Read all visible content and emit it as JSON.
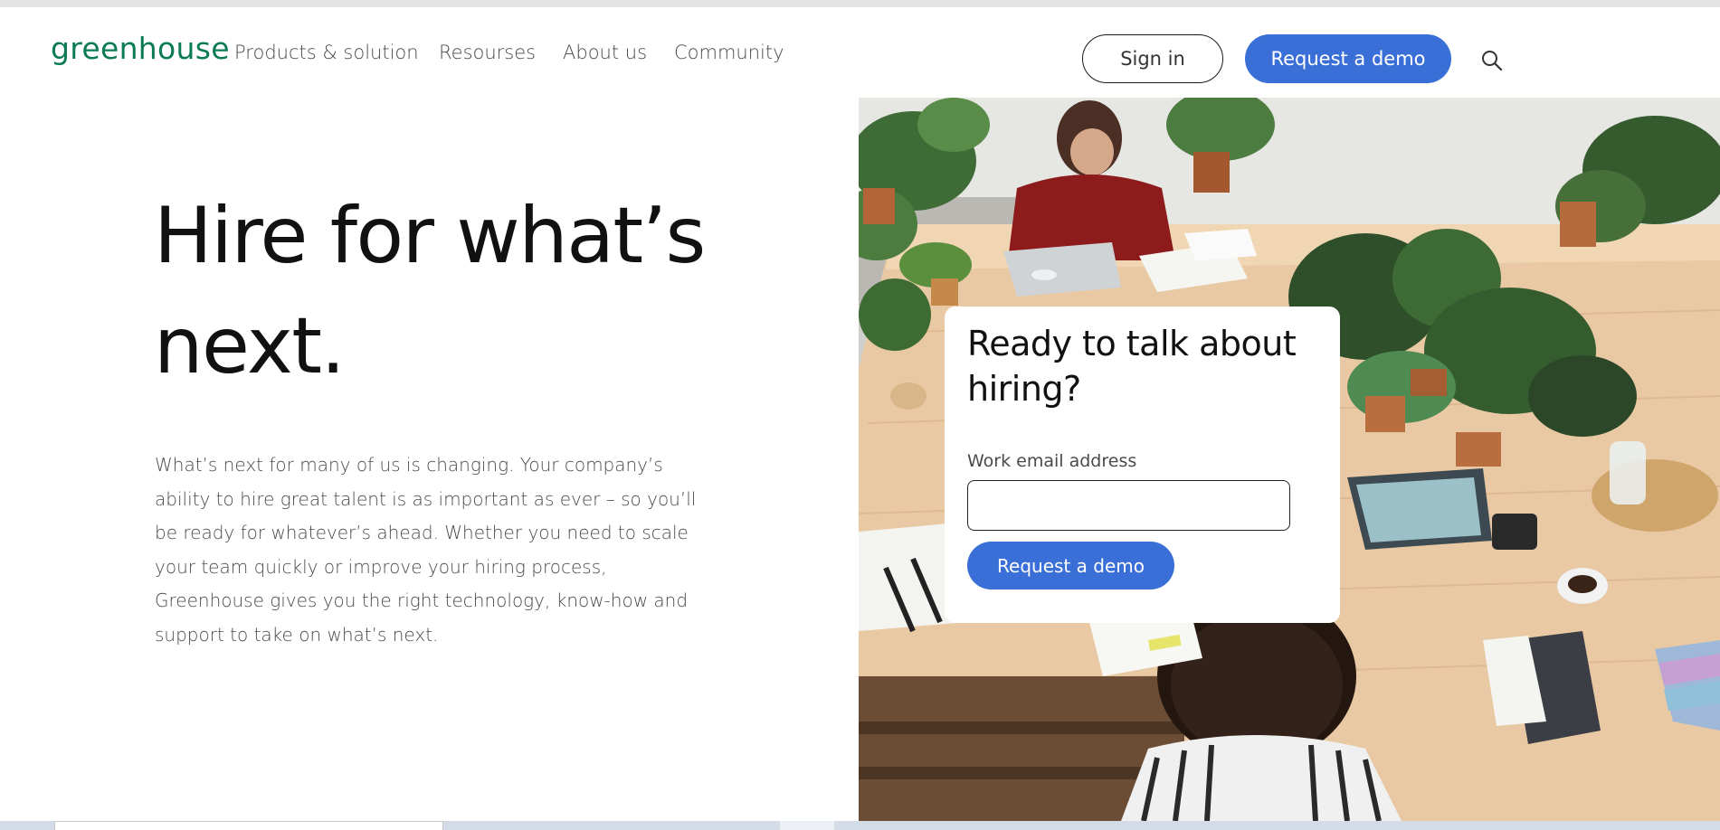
{
  "header": {
    "logo": "greenhouse",
    "nav": [
      "Products & solution",
      "Resourses",
      "About us",
      "Community"
    ],
    "sign_in": "Sign in",
    "request_demo": "Request a demo"
  },
  "hero": {
    "title_line1": "Hire for what’s",
    "title_line2": "next.",
    "body": "What’s next for many of us is changing. Your company’s ability to hire great talent is as important as ever – so you’ll be ready for whatever’s ahead. Whether you need to scale your team quickly or improve your hiring process, Greenhouse gives you the right technology, know-how and support to take on what’s next."
  },
  "form": {
    "title": "Ready to talk about hiring?",
    "email_label": "Work email address",
    "email_value": "",
    "button": "Request a demo"
  },
  "colors": {
    "brand_green": "#0b7a56",
    "primary_blue": "#3b6fd8"
  },
  "icons": {
    "search": "search-icon",
    "hero_photo": "office-table-with-plants-photo"
  }
}
